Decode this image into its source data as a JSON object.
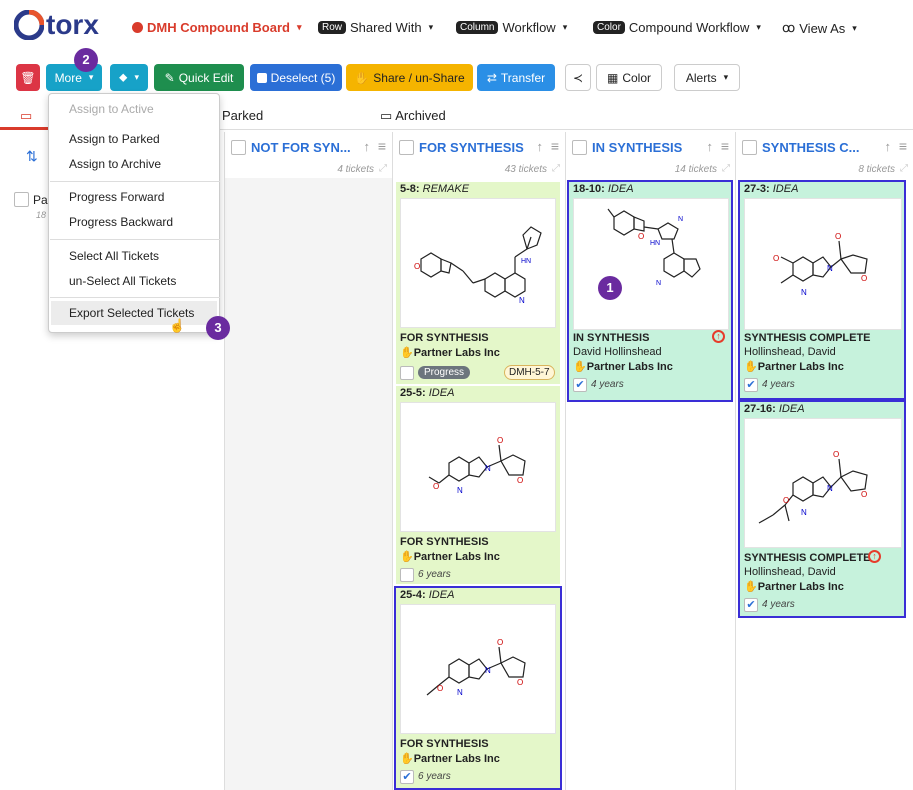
{
  "header": {
    "logo": "torx",
    "board": "DMH Compound Board",
    "row_pill": "Row",
    "row_label": "Shared With",
    "column_pill": "Column",
    "column_label": "Workflow",
    "color_pill": "Color",
    "color_label": "Compound Workflow",
    "view_as": "View As"
  },
  "toolbar": {
    "more": "More",
    "quick_edit": "Quick Edit",
    "deselect": "Deselect (5)",
    "share": "Share / un-Share",
    "transfer": "Transfer",
    "color": "Color",
    "alerts": "Alerts"
  },
  "tabs": {
    "parked": "Parked",
    "archived": "Archived"
  },
  "menu": {
    "items": [
      "Assign to Active",
      "Assign to Parked",
      "Assign to Archive",
      "Progress Forward",
      "Progress Backward",
      "Select All Tickets",
      "un-Select All Tickets",
      "Export Selected Tickets"
    ]
  },
  "columns": [
    {
      "title": "NOT FOR SYN...",
      "count": "4 tickets"
    },
    {
      "title": "FOR SYNTHESIS",
      "count": "43 tickets"
    },
    {
      "title": "IN SYNTHESIS",
      "count": "14 tickets"
    },
    {
      "title": "SYNTHESIS C...",
      "count": "8 tickets"
    }
  ],
  "parked_col": {
    "label": "Pa",
    "count": "18 ti"
  },
  "cards": {
    "c58": {
      "id": "5-8:",
      "tag": "REMAKE",
      "status": "FOR SYNTHESIS",
      "partner": "Partner Labs Inc",
      "progress": "Progress",
      "ref": "DMH-5-7"
    },
    "c255": {
      "id": "25-5:",
      "tag": "IDEA",
      "status": "FOR SYNTHESIS",
      "partner": "Partner Labs Inc",
      "age": "6 years"
    },
    "c254": {
      "id": "25-4:",
      "tag": "IDEA",
      "status": "FOR SYNTHESIS",
      "partner": "Partner Labs Inc",
      "age": "6 years"
    },
    "c1810": {
      "id": "18-10:",
      "tag": "IDEA",
      "status": "IN SYNTHESIS",
      "person": "David Hollinshead",
      "partner": "Partner Labs Inc",
      "age": "4 years"
    },
    "c273": {
      "id": "27-3:",
      "tag": "IDEA",
      "status": "SYNTHESIS COMPLETE",
      "person": "Hollinshead, David",
      "partner": "Partner Labs Inc",
      "age": "4 years"
    },
    "c2716": {
      "id": "27-16:",
      "tag": "IDEA",
      "status": "SYNTHESIS COMPLETE",
      "person": "Hollinshead, David",
      "partner": "Partner Labs Inc",
      "age": "4 years"
    }
  },
  "badges": [
    "1",
    "2",
    "3"
  ],
  "colors": {
    "accent": "#2b6fd6",
    "green_card": "#e4f7c9",
    "teal_card": "#c6f2dc",
    "select_border": "#3a2ed6",
    "badge": "#6a2b9f"
  }
}
